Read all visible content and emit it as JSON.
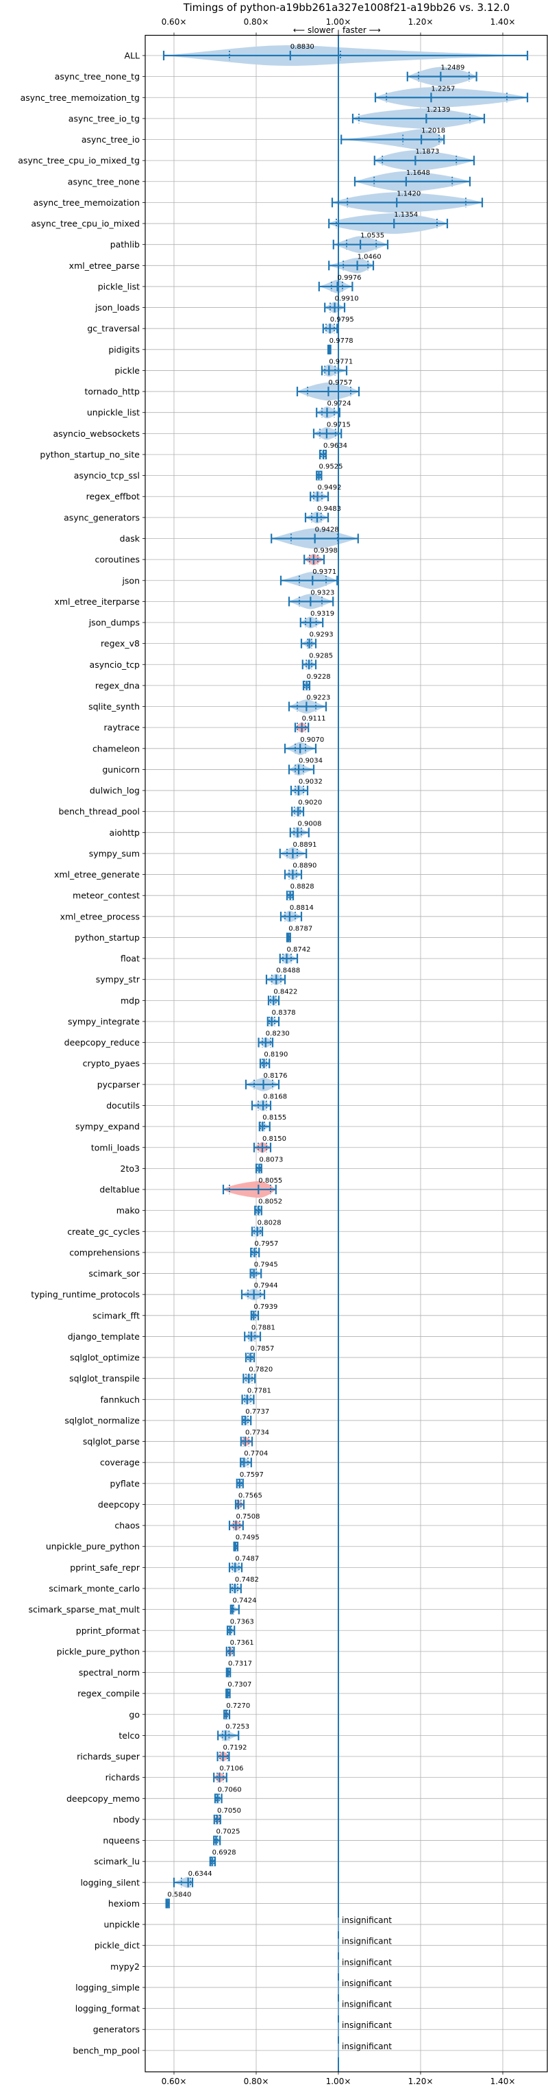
{
  "chart_data": {
    "type": "violin",
    "title": "Timings of python-a19bb261a327e1008f21-a19bb26 vs. 3.12.0",
    "xlabel": "",
    "ylabel": "",
    "direction_label": {
      "left": "⟵ slower",
      "right": "faster ⟶"
    },
    "xlim": [
      0.535,
      1.51
    ],
    "x_ticks": [
      0.6,
      0.8,
      1.0,
      1.2,
      1.4
    ],
    "x_tick_labels": [
      "0.60×",
      "0.80×",
      "1.00×",
      "1.20×",
      "1.40×"
    ],
    "reference_line": 1.0,
    "grid": true,
    "colors": {
      "line": "#1f77b4",
      "faster_fill": "#b9d3e9",
      "slower_fill": "#f9aaaa",
      "grid": "#b0b0b0"
    },
    "insignificant_label": "insignificant",
    "benchmarks": [
      {
        "name": "ALL",
        "value": 0.883,
        "min": 0.575,
        "q1": 0.735,
        "q3": 1.005,
        "max": 1.46,
        "color": "faster"
      },
      {
        "name": "async_tree_none_tg",
        "value": 1.2489,
        "min": 1.168,
        "q1": 1.195,
        "q3": 1.318,
        "max": 1.336,
        "color": "faster"
      },
      {
        "name": "async_tree_memoization_tg",
        "value": 1.2257,
        "min": 1.09,
        "q1": 1.117,
        "q3": 1.41,
        "max": 1.46,
        "color": "faster"
      },
      {
        "name": "async_tree_io_tg",
        "value": 1.2139,
        "min": 1.035,
        "q1": 1.05,
        "q3": 1.32,
        "max": 1.355,
        "color": "faster"
      },
      {
        "name": "async_tree_io",
        "value": 1.2018,
        "min": 1.007,
        "q1": 1.157,
        "q3": 1.245,
        "max": 1.257,
        "color": "faster"
      },
      {
        "name": "async_tree_cpu_io_mixed_tg",
        "value": 1.1873,
        "min": 1.088,
        "q1": 1.107,
        "q3": 1.287,
        "max": 1.33,
        "color": "faster"
      },
      {
        "name": "async_tree_none",
        "value": 1.1648,
        "min": 1.04,
        "q1": 1.087,
        "q3": 1.277,
        "max": 1.32,
        "color": "faster"
      },
      {
        "name": "async_tree_memoization",
        "value": 1.142,
        "min": 0.985,
        "q1": 1.022,
        "q3": 1.31,
        "max": 1.35,
        "color": "faster"
      },
      {
        "name": "async_tree_cpu_io_mixed",
        "value": 1.1354,
        "min": 0.977,
        "q1": 0.995,
        "q3": 1.24,
        "max": 1.265,
        "color": "faster"
      },
      {
        "name": "pathlib",
        "value": 1.0535,
        "min": 0.988,
        "q1": 1.02,
        "q3": 1.092,
        "max": 1.12,
        "color": "faster"
      },
      {
        "name": "xml_etree_parse",
        "value": 1.046,
        "min": 0.977,
        "q1": 1.012,
        "q3": 1.072,
        "max": 1.085,
        "color": "faster"
      },
      {
        "name": "pickle_list",
        "value": 0.9976,
        "min": 0.953,
        "q1": 0.983,
        "q3": 1.01,
        "max": 1.034,
        "color": "faster"
      },
      {
        "name": "json_loads",
        "value": 0.991,
        "min": 0.967,
        "q1": 0.98,
        "q3": 1.0,
        "max": 1.015,
        "color": "faster"
      },
      {
        "name": "gc_traversal",
        "value": 0.9795,
        "min": 0.963,
        "q1": 0.97,
        "q3": 0.99,
        "max": 0.997,
        "color": "faster"
      },
      {
        "name": "pidigits",
        "value": 0.9778,
        "min": 0.975,
        "q1": 0.976,
        "q3": 0.979,
        "max": 0.981,
        "color": "faster"
      },
      {
        "name": "pickle",
        "value": 0.9771,
        "min": 0.96,
        "q1": 0.967,
        "q3": 0.992,
        "max": 1.02,
        "color": "faster"
      },
      {
        "name": "tornado_http",
        "value": 0.9757,
        "min": 0.9,
        "q1": 0.925,
        "q3": 1.03,
        "max": 1.05,
        "color": "faster"
      },
      {
        "name": "unpickle_list",
        "value": 0.9724,
        "min": 0.947,
        "q1": 0.96,
        "q3": 0.99,
        "max": 1.003,
        "color": "faster"
      },
      {
        "name": "asyncio_websockets",
        "value": 0.9715,
        "min": 0.94,
        "q1": 0.955,
        "q3": 0.993,
        "max": 1.007,
        "color": "faster"
      },
      {
        "name": "python_startup_no_site",
        "value": 0.9634,
        "min": 0.955,
        "q1": 0.958,
        "q3": 0.967,
        "max": 0.97,
        "color": "faster"
      },
      {
        "name": "asyncio_tcp_ssl",
        "value": 0.9525,
        "min": 0.947,
        "q1": 0.949,
        "q3": 0.956,
        "max": 0.959,
        "color": "faster"
      },
      {
        "name": "regex_effbot",
        "value": 0.9492,
        "min": 0.932,
        "q1": 0.94,
        "q3": 0.96,
        "max": 0.975,
        "color": "faster"
      },
      {
        "name": "async_generators",
        "value": 0.9483,
        "min": 0.92,
        "q1": 0.935,
        "q3": 0.958,
        "max": 0.975,
        "color": "faster"
      },
      {
        "name": "dask",
        "value": 0.9428,
        "min": 0.837,
        "q1": 0.885,
        "q3": 0.998,
        "max": 1.048,
        "color": "faster"
      },
      {
        "name": "coroutines",
        "value": 0.9398,
        "min": 0.917,
        "q1": 0.93,
        "q3": 0.95,
        "max": 0.965,
        "color": "slower"
      },
      {
        "name": "json",
        "value": 0.9371,
        "min": 0.86,
        "q1": 0.905,
        "q3": 0.97,
        "max": 0.997,
        "color": "faster"
      },
      {
        "name": "xml_etree_iterparse",
        "value": 0.9323,
        "min": 0.88,
        "q1": 0.905,
        "q3": 0.96,
        "max": 0.987,
        "color": "faster"
      },
      {
        "name": "json_dumps",
        "value": 0.9319,
        "min": 0.908,
        "q1": 0.92,
        "q3": 0.946,
        "max": 0.962,
        "color": "faster"
      },
      {
        "name": "regex_v8",
        "value": 0.9293,
        "min": 0.91,
        "q1": 0.925,
        "q3": 0.935,
        "max": 0.945,
        "color": "faster"
      },
      {
        "name": "asyncio_tcp",
        "value": 0.9285,
        "min": 0.913,
        "q1": 0.922,
        "q3": 0.935,
        "max": 0.945,
        "color": "faster"
      },
      {
        "name": "regex_dna",
        "value": 0.9228,
        "min": 0.915,
        "q1": 0.918,
        "q3": 0.927,
        "max": 0.93,
        "color": "faster"
      },
      {
        "name": "sqlite_synth",
        "value": 0.9223,
        "min": 0.88,
        "q1": 0.9,
        "q3": 0.945,
        "max": 0.97,
        "color": "faster"
      },
      {
        "name": "raytrace",
        "value": 0.9111,
        "min": 0.895,
        "q1": 0.9,
        "q3": 0.92,
        "max": 0.927,
        "color": "slower"
      },
      {
        "name": "chameleon",
        "value": 0.907,
        "min": 0.87,
        "q1": 0.895,
        "q3": 0.92,
        "max": 0.945,
        "color": "faster"
      },
      {
        "name": "gunicorn",
        "value": 0.9034,
        "min": 0.88,
        "q1": 0.895,
        "q3": 0.915,
        "max": 0.94,
        "color": "faster"
      },
      {
        "name": "dulwich_log",
        "value": 0.9032,
        "min": 0.885,
        "q1": 0.895,
        "q3": 0.915,
        "max": 0.925,
        "color": "faster"
      },
      {
        "name": "bench_thread_pool",
        "value": 0.902,
        "min": 0.887,
        "q1": 0.893,
        "q3": 0.907,
        "max": 0.915,
        "color": "faster"
      },
      {
        "name": "aiohttp",
        "value": 0.9008,
        "min": 0.883,
        "q1": 0.892,
        "q3": 0.91,
        "max": 0.928,
        "color": "faster"
      },
      {
        "name": "sympy_sum",
        "value": 0.8891,
        "min": 0.858,
        "q1": 0.875,
        "q3": 0.9,
        "max": 0.922,
        "color": "faster"
      },
      {
        "name": "xml_etree_generate",
        "value": 0.889,
        "min": 0.87,
        "q1": 0.88,
        "q3": 0.898,
        "max": 0.91,
        "color": "faster"
      },
      {
        "name": "meteor_contest",
        "value": 0.8828,
        "min": 0.875,
        "q1": 0.879,
        "q3": 0.887,
        "max": 0.89,
        "color": "faster"
      },
      {
        "name": "xml_etree_process",
        "value": 0.8814,
        "min": 0.86,
        "q1": 0.87,
        "q3": 0.895,
        "max": 0.91,
        "color": "faster"
      },
      {
        "name": "python_startup",
        "value": 0.8787,
        "min": 0.875,
        "q1": 0.876,
        "q3": 0.881,
        "max": 0.883,
        "color": "faster"
      },
      {
        "name": "float",
        "value": 0.8742,
        "min": 0.858,
        "q1": 0.865,
        "q3": 0.885,
        "max": 0.9,
        "color": "faster"
      },
      {
        "name": "sympy_str",
        "value": 0.8488,
        "min": 0.825,
        "q1": 0.838,
        "q3": 0.86,
        "max": 0.87,
        "color": "faster"
      },
      {
        "name": "mdp",
        "value": 0.8422,
        "min": 0.83,
        "q1": 0.835,
        "q3": 0.848,
        "max": 0.855,
        "color": "faster"
      },
      {
        "name": "sympy_integrate",
        "value": 0.8378,
        "min": 0.828,
        "q1": 0.832,
        "q3": 0.845,
        "max": 0.855,
        "color": "faster"
      },
      {
        "name": "deepcopy_reduce",
        "value": 0.823,
        "min": 0.806,
        "q1": 0.815,
        "q3": 0.835,
        "max": 0.84,
        "color": "faster"
      },
      {
        "name": "crypto_pyaes",
        "value": 0.819,
        "min": 0.81,
        "q1": 0.815,
        "q3": 0.825,
        "max": 0.832,
        "color": "faster"
      },
      {
        "name": "pycparser",
        "value": 0.8176,
        "min": 0.775,
        "q1": 0.795,
        "q3": 0.84,
        "max": 0.855,
        "color": "faster"
      },
      {
        "name": "docutils",
        "value": 0.8168,
        "min": 0.79,
        "q1": 0.805,
        "q3": 0.825,
        "max": 0.835,
        "color": "faster"
      },
      {
        "name": "sympy_expand",
        "value": 0.8155,
        "min": 0.808,
        "q1": 0.81,
        "q3": 0.82,
        "max": 0.833,
        "color": "faster"
      },
      {
        "name": "tomli_loads",
        "value": 0.815,
        "min": 0.795,
        "q1": 0.805,
        "q3": 0.825,
        "max": 0.835,
        "color": "slower"
      },
      {
        "name": "2to3",
        "value": 0.8073,
        "min": 0.8,
        "q1": 0.803,
        "q3": 0.81,
        "max": 0.813,
        "color": "faster"
      },
      {
        "name": "deltablue",
        "value": 0.8055,
        "min": 0.72,
        "q1": 0.735,
        "q3": 0.835,
        "max": 0.848,
        "color": "slower"
      },
      {
        "name": "mako",
        "value": 0.8052,
        "min": 0.797,
        "q1": 0.8,
        "q3": 0.808,
        "max": 0.813,
        "color": "faster"
      },
      {
        "name": "create_gc_cycles",
        "value": 0.8028,
        "min": 0.79,
        "q1": 0.795,
        "q3": 0.81,
        "max": 0.815,
        "color": "faster"
      },
      {
        "name": "comprehensions",
        "value": 0.7957,
        "min": 0.787,
        "q1": 0.79,
        "q3": 0.8,
        "max": 0.807,
        "color": "faster"
      },
      {
        "name": "scimark_sor",
        "value": 0.7945,
        "min": 0.786,
        "q1": 0.79,
        "q3": 0.8,
        "max": 0.812,
        "color": "faster"
      },
      {
        "name": "typing_runtime_protocols",
        "value": 0.7944,
        "min": 0.765,
        "q1": 0.78,
        "q3": 0.81,
        "max": 0.82,
        "color": "faster"
      },
      {
        "name": "scimark_fft",
        "value": 0.7939,
        "min": 0.788,
        "q1": 0.79,
        "q3": 0.798,
        "max": 0.805,
        "color": "faster"
      },
      {
        "name": "django_template",
        "value": 0.7881,
        "min": 0.772,
        "q1": 0.782,
        "q3": 0.797,
        "max": 0.81,
        "color": "faster"
      },
      {
        "name": "sqlglot_optimize",
        "value": 0.7857,
        "min": 0.775,
        "q1": 0.78,
        "q3": 0.79,
        "max": 0.795,
        "color": "faster"
      },
      {
        "name": "sqlglot_transpile",
        "value": 0.782,
        "min": 0.769,
        "q1": 0.775,
        "q3": 0.79,
        "max": 0.797,
        "color": "faster"
      },
      {
        "name": "fannkuch",
        "value": 0.7781,
        "min": 0.766,
        "q1": 0.772,
        "q3": 0.787,
        "max": 0.794,
        "color": "faster"
      },
      {
        "name": "sqlglot_normalize",
        "value": 0.7737,
        "min": 0.766,
        "q1": 0.77,
        "q3": 0.78,
        "max": 0.787,
        "color": "faster"
      },
      {
        "name": "sqlglot_parse",
        "value": 0.7734,
        "min": 0.763,
        "q1": 0.768,
        "q3": 0.782,
        "max": 0.79,
        "color": "slower"
      },
      {
        "name": "coverage",
        "value": 0.7704,
        "min": 0.762,
        "q1": 0.766,
        "q3": 0.78,
        "max": 0.788,
        "color": "faster"
      },
      {
        "name": "pyflate",
        "value": 0.7597,
        "min": 0.753,
        "q1": 0.757,
        "q3": 0.764,
        "max": 0.768,
        "color": "faster"
      },
      {
        "name": "deepcopy",
        "value": 0.7565,
        "min": 0.75,
        "q1": 0.754,
        "q3": 0.763,
        "max": 0.77,
        "color": "slower"
      },
      {
        "name": "chaos",
        "value": 0.7508,
        "min": 0.735,
        "q1": 0.745,
        "q3": 0.76,
        "max": 0.768,
        "color": "slower"
      },
      {
        "name": "unpickle_pure_python",
        "value": 0.7495,
        "min": 0.746,
        "q1": 0.747,
        "q3": 0.752,
        "max": 0.755,
        "color": "slower"
      },
      {
        "name": "pprint_safe_repr",
        "value": 0.7487,
        "min": 0.735,
        "q1": 0.742,
        "q3": 0.758,
        "max": 0.765,
        "color": "faster"
      },
      {
        "name": "scimark_monte_carlo",
        "value": 0.7482,
        "min": 0.737,
        "q1": 0.742,
        "q3": 0.755,
        "max": 0.763,
        "color": "faster"
      },
      {
        "name": "scimark_sparse_mat_mult",
        "value": 0.7424,
        "min": 0.738,
        "q1": 0.74,
        "q3": 0.745,
        "max": 0.758,
        "color": "faster"
      },
      {
        "name": "pprint_pformat",
        "value": 0.7363,
        "min": 0.73,
        "q1": 0.733,
        "q3": 0.74,
        "max": 0.747,
        "color": "faster"
      },
      {
        "name": "pickle_pure_python",
        "value": 0.7361,
        "min": 0.728,
        "q1": 0.733,
        "q3": 0.742,
        "max": 0.746,
        "color": "slower"
      },
      {
        "name": "spectral_norm",
        "value": 0.7317,
        "min": 0.728,
        "q1": 0.73,
        "q3": 0.734,
        "max": 0.737,
        "color": "faster"
      },
      {
        "name": "regex_compile",
        "value": 0.7307,
        "min": 0.727,
        "q1": 0.729,
        "q3": 0.733,
        "max": 0.736,
        "color": "faster"
      },
      {
        "name": "go",
        "value": 0.727,
        "min": 0.722,
        "q1": 0.725,
        "q3": 0.73,
        "max": 0.735,
        "color": "slower"
      },
      {
        "name": "telco",
        "value": 0.7253,
        "min": 0.707,
        "q1": 0.718,
        "q3": 0.734,
        "max": 0.757,
        "color": "faster"
      },
      {
        "name": "richards_super",
        "value": 0.7192,
        "min": 0.706,
        "q1": 0.712,
        "q3": 0.73,
        "max": 0.734,
        "color": "slower"
      },
      {
        "name": "richards",
        "value": 0.7106,
        "min": 0.697,
        "q1": 0.705,
        "q3": 0.72,
        "max": 0.728,
        "color": "slower"
      },
      {
        "name": "deepcopy_memo",
        "value": 0.706,
        "min": 0.7,
        "q1": 0.703,
        "q3": 0.71,
        "max": 0.716,
        "color": "faster"
      },
      {
        "name": "nbody",
        "value": 0.705,
        "min": 0.698,
        "q1": 0.702,
        "q3": 0.71,
        "max": 0.713,
        "color": "slower"
      },
      {
        "name": "nqueens",
        "value": 0.7025,
        "min": 0.697,
        "q1": 0.7,
        "q3": 0.706,
        "max": 0.712,
        "color": "faster"
      },
      {
        "name": "scimark_lu",
        "value": 0.6928,
        "min": 0.688,
        "q1": 0.69,
        "q3": 0.697,
        "max": 0.7,
        "color": "faster"
      },
      {
        "name": "logging_silent",
        "value": 0.6344,
        "min": 0.6,
        "q1": 0.618,
        "q3": 0.64,
        "max": 0.645,
        "color": "faster"
      },
      {
        "name": "hexiom",
        "value": 0.584,
        "min": 0.581,
        "q1": 0.582,
        "q3": 0.586,
        "max": 0.588,
        "color": "slower"
      },
      {
        "name": "unpickle",
        "value": null,
        "insignificant": true
      },
      {
        "name": "pickle_dict",
        "value": null,
        "insignificant": true
      },
      {
        "name": "mypy2",
        "value": null,
        "insignificant": true
      },
      {
        "name": "logging_simple",
        "value": null,
        "insignificant": true
      },
      {
        "name": "logging_format",
        "value": null,
        "insignificant": true
      },
      {
        "name": "generators",
        "value": null,
        "insignificant": true
      },
      {
        "name": "bench_mp_pool",
        "value": null,
        "insignificant": true
      }
    ]
  }
}
